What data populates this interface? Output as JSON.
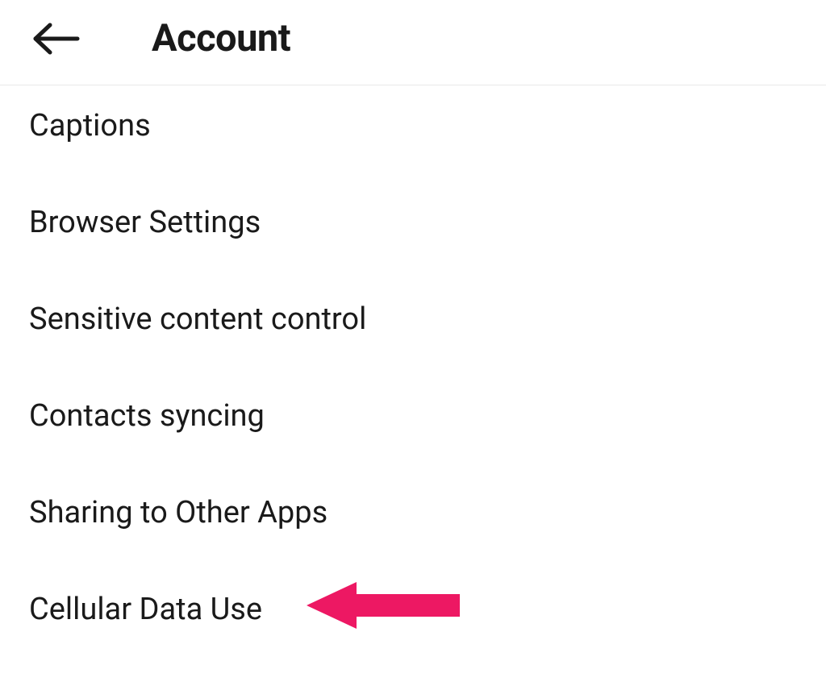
{
  "header": {
    "title": "Account"
  },
  "items": [
    {
      "label": "Captions"
    },
    {
      "label": "Browser Settings"
    },
    {
      "label": "Sensitive content control"
    },
    {
      "label": "Contacts syncing"
    },
    {
      "label": "Sharing to Other Apps"
    },
    {
      "label": "Cellular Data Use",
      "highlighted": true
    }
  ],
  "annotation": {
    "arrow_color": "#ed1863"
  }
}
